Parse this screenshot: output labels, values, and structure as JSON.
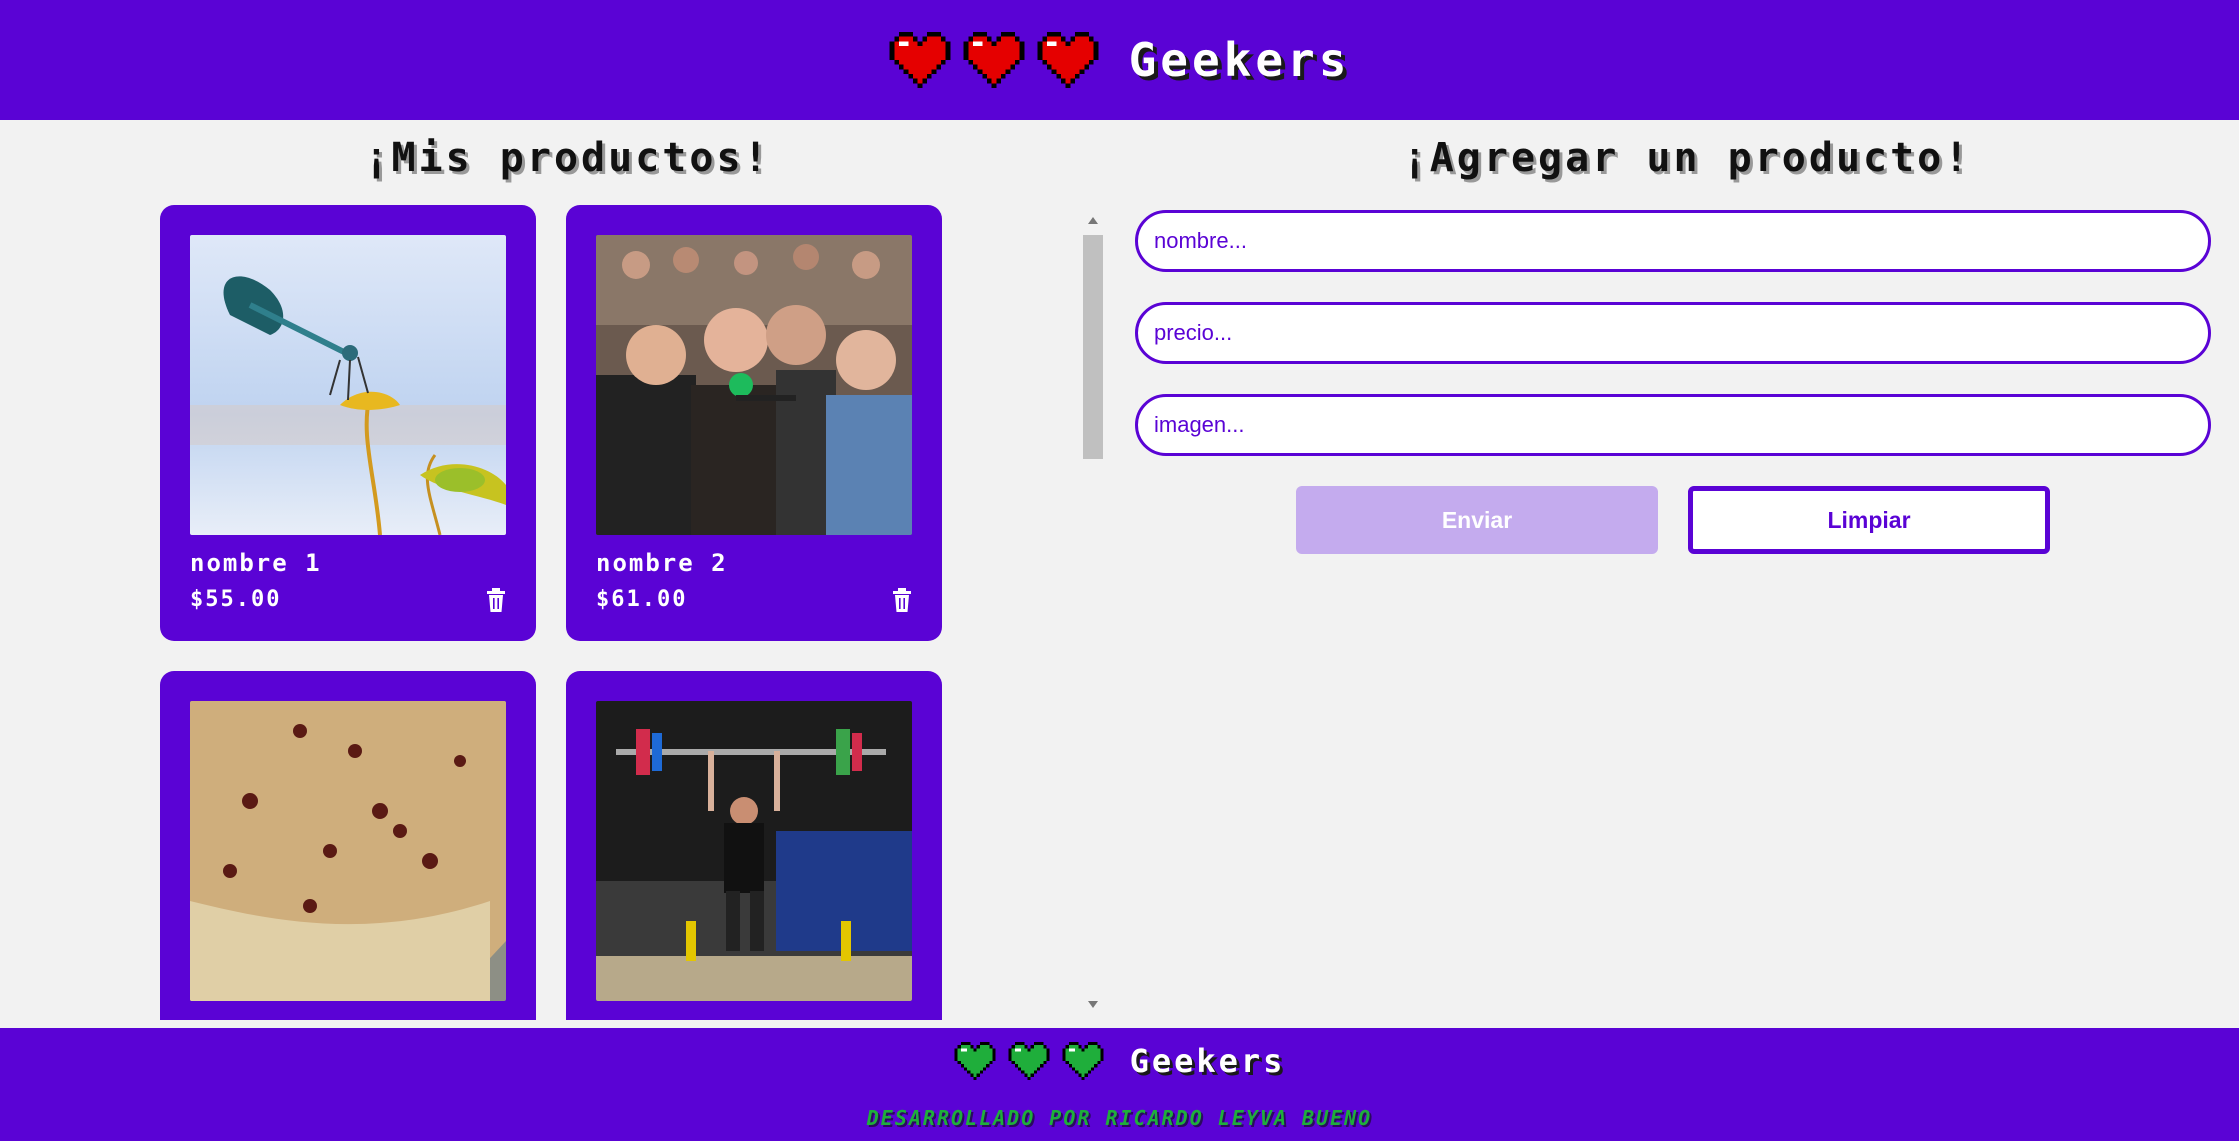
{
  "header": {
    "brand": "Geekers",
    "hearts": [
      "heart-icon",
      "heart-icon",
      "heart-icon"
    ],
    "heart_color": "#e50000"
  },
  "products_section": {
    "title": "¡Mis productos!",
    "items": [
      {
        "name": "nombre 1",
        "price": "$55.00",
        "image": "dragonfly"
      },
      {
        "name": "nombre 2",
        "price": "$61.00",
        "image": "crowd-interview"
      },
      {
        "name": "",
        "price": "",
        "image": "cake"
      },
      {
        "name": "",
        "price": "",
        "image": "weightlifter"
      }
    ]
  },
  "form_section": {
    "title": "¡Agregar un producto!",
    "name_placeholder": "nombre...",
    "price_placeholder": "precio...",
    "image_placeholder": "imagen...",
    "send_label": "Enviar",
    "clear_label": "Limpiar"
  },
  "footer": {
    "brand": "Geekers",
    "heart_color": "#1fae3b",
    "credits": "DESARROLLADO POR RICARDO LEYVA BUENO"
  },
  "colors": {
    "primary": "#5a03d5",
    "background": "#f2f2f2",
    "disabled_button": "#c4abee"
  }
}
